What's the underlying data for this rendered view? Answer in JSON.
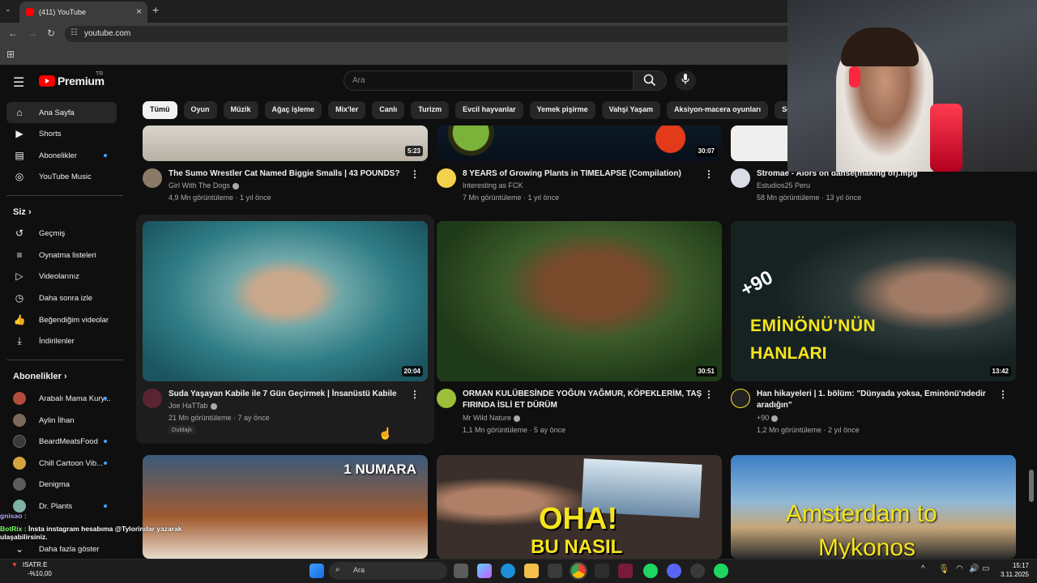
{
  "browser": {
    "tab_title": "(411) YouTube",
    "url": "youtube.com"
  },
  "header": {
    "logo_text": "Premium",
    "region": "TR",
    "search_placeholder": "Ara"
  },
  "sidebar": {
    "main": [
      {
        "label": "Ana Sayfa",
        "icon": "home-icon"
      },
      {
        "label": "Shorts",
        "icon": "shorts-icon"
      },
      {
        "label": "Abonelikler",
        "icon": "subscriptions-icon"
      },
      {
        "label": "YouTube Music",
        "icon": "music-icon"
      }
    ],
    "you_heading": "Siz",
    "you": [
      {
        "label": "Geçmiş",
        "icon": "history-icon"
      },
      {
        "label": "Oynatma listeleri",
        "icon": "playlist-icon"
      },
      {
        "label": "Videolarınız",
        "icon": "your-videos-icon"
      },
      {
        "label": "Daha sonra izle",
        "icon": "watch-later-icon"
      },
      {
        "label": "Beğendiğim videolar",
        "icon": "liked-icon"
      },
      {
        "label": "İndirilenler",
        "icon": "download-icon"
      }
    ],
    "subs_heading": "Abonelikler",
    "subs": [
      {
        "label": "Arabalı Mama Kury...",
        "color": "#b44a3a"
      },
      {
        "label": "Aylin İlhan",
        "color": "#7a6a5c"
      },
      {
        "label": "BeardMeatsFood",
        "color": "#3a3a3a"
      },
      {
        "label": "Chill Cartoon Vib...",
        "color": "#d4a540"
      },
      {
        "label": "Denigma",
        "color": "#5c5c5c"
      },
      {
        "label": "Dr. Plants",
        "color": "#7db2a4"
      }
    ],
    "show_more": "Daha fazla göster"
  },
  "chips": [
    "Tümü",
    "Oyun",
    "Müzik",
    "Ağaç işleme",
    "Mix'ler",
    "Canlı",
    "Turizm",
    "Evcil hayvanlar",
    "Yemek pişirme",
    "Vahşi Yaşam",
    "Aksiyon-macera oyunları",
    "Son yükler"
  ],
  "videos": [
    {
      "title": "The Sumo Wrestler Cat Named Biggie Smalls | 43 POUNDS?",
      "channel": "Girl With The Dogs",
      "views": "4,9 Mn görüntüleme",
      "age": "1 yıl önce",
      "duration": "5:23"
    },
    {
      "title": "8 YEARS of Growing Plants in TIMELAPSE (Compilation)",
      "channel": "Interesting as FCK",
      "views": "7 Mn görüntüleme",
      "age": "1 yıl önce",
      "duration": "30:07"
    },
    {
      "title": "Stromae - Alors on danse(making of).mpg",
      "channel": "Estudios25 Peru",
      "views": "58 Mn görüntüleme",
      "age": "13 yıl önce",
      "duration": ""
    },
    {
      "title": "Suda Yaşayan Kabile ile 7 Gün Geçirmek | İnsanüstü Kabile",
      "channel": "Joe HaTTab",
      "views": "21 Mn görüntüleme",
      "age": "7 ay önce",
      "duration": "20:04",
      "badge": "Dublajlı"
    },
    {
      "title": "ORMAN KULÜBESİNDE YOĞUN YAĞMUR, KÖPEKLERİM, TAŞ FIRINDA İSLİ ET DÜRÜM",
      "channel": "Mr Wild Nature",
      "views": "1,1 Mn görüntüleme",
      "age": "5 ay önce",
      "duration": "30:51"
    },
    {
      "title": "Han hikayeleri | 1. bölüm: \"Dünyada yoksa, Eminönü'ndedir aradığın\"",
      "channel": "+90",
      "views": "1,2 Mn görüntüleme",
      "age": "2 yıl önce",
      "duration": "13:42",
      "thumb_text1": "EMİNÖNÜ'NÜN",
      "thumb_text2": "HANLARI",
      "thumb_badge": "+90"
    },
    {
      "title": "",
      "channel": "",
      "views": "",
      "age": "",
      "duration": "",
      "thumb_text1": "1 NUMARA"
    },
    {
      "title": "",
      "channel": "",
      "views": "",
      "age": "",
      "duration": "",
      "thumb_text1": "OHA!",
      "thumb_text2": "BU NASIL"
    },
    {
      "title": "",
      "channel": "",
      "views": "",
      "age": "",
      "duration": "",
      "thumb_text1": "Amsterdam to",
      "thumb_text2": "Mykonos"
    }
  ],
  "chat": [
    {
      "user": "gnisao :",
      "text": ""
    },
    {
      "user": "BotRix :",
      "text": "İnsta instagram hesabıma @Tylorindar yazarak ulaşabilirsiniz."
    }
  ],
  "taskbar": {
    "weather_title": "ISATR.E",
    "weather_sub": "-%10,00",
    "search": "Ara",
    "time": "15:17",
    "date": "3.11.2025"
  }
}
